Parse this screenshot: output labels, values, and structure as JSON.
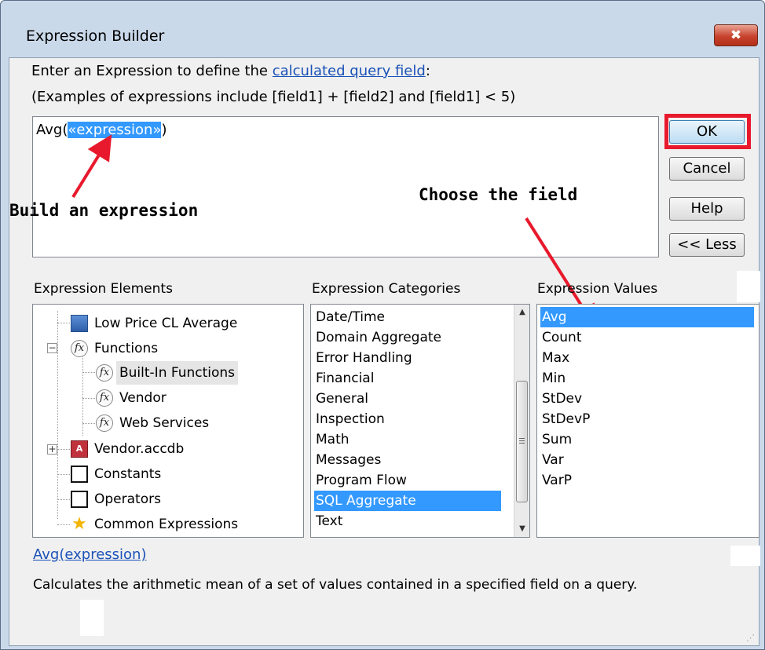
{
  "window": {
    "title": "Expression Builder",
    "close_glyph": "✖"
  },
  "instructions": {
    "line1_prefix": "Enter an Expression to define the ",
    "line1_link": "calculated query field",
    "line1_suffix": ":",
    "line2": "(Examples of expressions include [field1] + [field2] and [field1] < 5)"
  },
  "expression": {
    "prefix": "Avg(",
    "placeholder": "«expression»",
    "suffix": ")"
  },
  "buttons": {
    "ok": "OK",
    "cancel": "Cancel",
    "help": "Help",
    "less": "<< Less"
  },
  "annotations": {
    "build": "Build an expression",
    "choose": "Choose the field",
    "color": "#e8192c"
  },
  "panes": {
    "elements_label": "Expression Elements",
    "categories_label": "Expression Categories",
    "values_label": "Expression Values"
  },
  "elements": [
    {
      "label": "Low Price CL Average",
      "icon": "table-icon"
    },
    {
      "label": "Functions",
      "icon": "fx-icon",
      "expander": "−"
    },
    {
      "label": "Built-In Functions",
      "icon": "fx-icon"
    },
    {
      "label": "Vendor",
      "icon": "fx-icon"
    },
    {
      "label": "Web Services",
      "icon": "fx-icon"
    },
    {
      "label": "Vendor.accdb",
      "icon": "access-db-icon",
      "expander": "+"
    },
    {
      "label": "Constants",
      "icon": "constants-icon"
    },
    {
      "label": "Operators",
      "icon": "operators-icon"
    },
    {
      "label": "Common Expressions",
      "icon": "star-icon"
    }
  ],
  "categories": [
    "Date/Time",
    "Domain Aggregate",
    "Error Handling",
    "Financial",
    "General",
    "Inspection",
    "Math",
    "Messages",
    "Program Flow",
    "SQL Aggregate",
    "Text"
  ],
  "categories_selected": "SQL Aggregate",
  "values": [
    "Avg",
    "Count",
    "Max",
    "Min",
    "StDev",
    "StDevP",
    "Sum",
    "Var",
    "VarP"
  ],
  "values_selected": "Avg",
  "help": {
    "link": "Avg(expression)",
    "description": "Calculates the arithmetic mean of a set of values contained in a specified field on a query."
  },
  "colors": {
    "selection": "#3399ff",
    "link": "#1a52b8",
    "ok_highlight": "#e8192c",
    "title_bg": "#cad9ea"
  }
}
